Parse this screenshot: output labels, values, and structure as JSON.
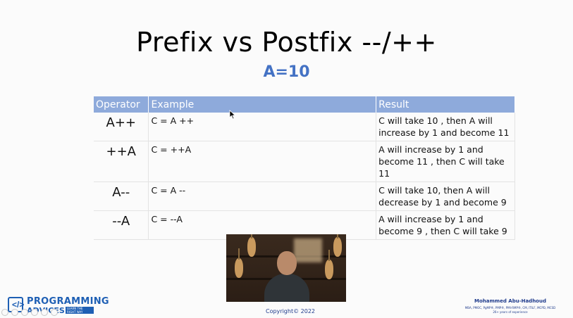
{
  "slide": {
    "title": "Prefix vs Postfix --/++",
    "subtitle": "A=10"
  },
  "table": {
    "headers": {
      "operator": "Operator",
      "example": "Example",
      "result": "Result"
    },
    "rows": [
      {
        "operator": "A++",
        "example": "C = A ++",
        "result": "C will take 10   , then A will increase by 1 and become 11"
      },
      {
        "operator": "++A",
        "example": "C = ++A",
        "result": "A will increase by 1 and become 11 , then C will take 11"
      },
      {
        "operator": "A--",
        "example": "C = A --",
        "result": "C will take 10, then A will decrease by 1 and become 9"
      },
      {
        "operator": "--A",
        "example": "C = --A",
        "result": "A will increase by 1 and become 9 , then C will take 9"
      }
    ]
  },
  "footer": {
    "copyright": "Copyright© 2022",
    "logo": {
      "top": "PROGRAMMING",
      "bottom": "ADVICES",
      "tagline": "LEARN THE RIGHT WAY"
    },
    "author": {
      "name": "Mohammed Abu-Hadhoud",
      "credentials": "MBA, PMOC, PgMP®, PMP®, PMI-RMP®, CM, ITILF, MCPD, MCSD",
      "experience": "26+ years of experience"
    }
  },
  "colors": {
    "header_bg": "#8eaadb",
    "accent": "#4472c4",
    "brand": "#1e5fb4"
  },
  "icons": {
    "cursor": "arrow-cursor-icon",
    "logo": "programming-advices-logo-icon"
  }
}
